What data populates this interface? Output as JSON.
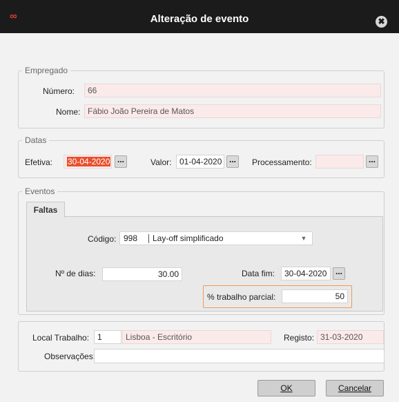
{
  "window": {
    "title": "Alteração de evento",
    "logo": "∞",
    "close_glyph": "✖"
  },
  "empregado": {
    "legend": "Empregado",
    "numero_label": "Número:",
    "numero_value": "66",
    "nome_label": "Nome:",
    "nome_value": "Fábio João Pereira de Matos"
  },
  "datas": {
    "legend": "Datas",
    "efetiva_label": "Efetiva:",
    "efetiva_value": "30-04-2020",
    "valor_label": "Valor:",
    "valor_value": "01-04-2020",
    "processamento_label": "Processamento:",
    "processamento_value": "",
    "picker_label": "..."
  },
  "eventos": {
    "legend": "Eventos",
    "tab_label": "Faltas",
    "codigo_label": "Código:",
    "codigo_value": "998",
    "codigo_desc": "Lay-off simplificado",
    "dias_label": "Nº de dias:",
    "dias_value": "30.00",
    "data_fim_label": "Data fim:",
    "data_fim_value": "30-04-2020",
    "trabalho_label": "% trabalho parcial:",
    "trabalho_value": "50"
  },
  "local": {
    "label": "Local Trabalho:",
    "code": "1",
    "name": "Lisboa - Escritório",
    "registo_label": "Registo:",
    "registo_value": "31-03-2020",
    "obs_label": "Observações:",
    "obs_value": ""
  },
  "buttons": {
    "ok_label": "OK",
    "cancel_label": "Cancelar"
  },
  "colors": {
    "titlebar": "#1b1b1b",
    "accent": "#e8502c",
    "highlight": "#f09a55",
    "readonly_bg": "#fbeaea"
  },
  "icons": {
    "logo": "infinity-logo-icon",
    "close": "close-icon",
    "dropdown": "chevron-down-icon"
  }
}
